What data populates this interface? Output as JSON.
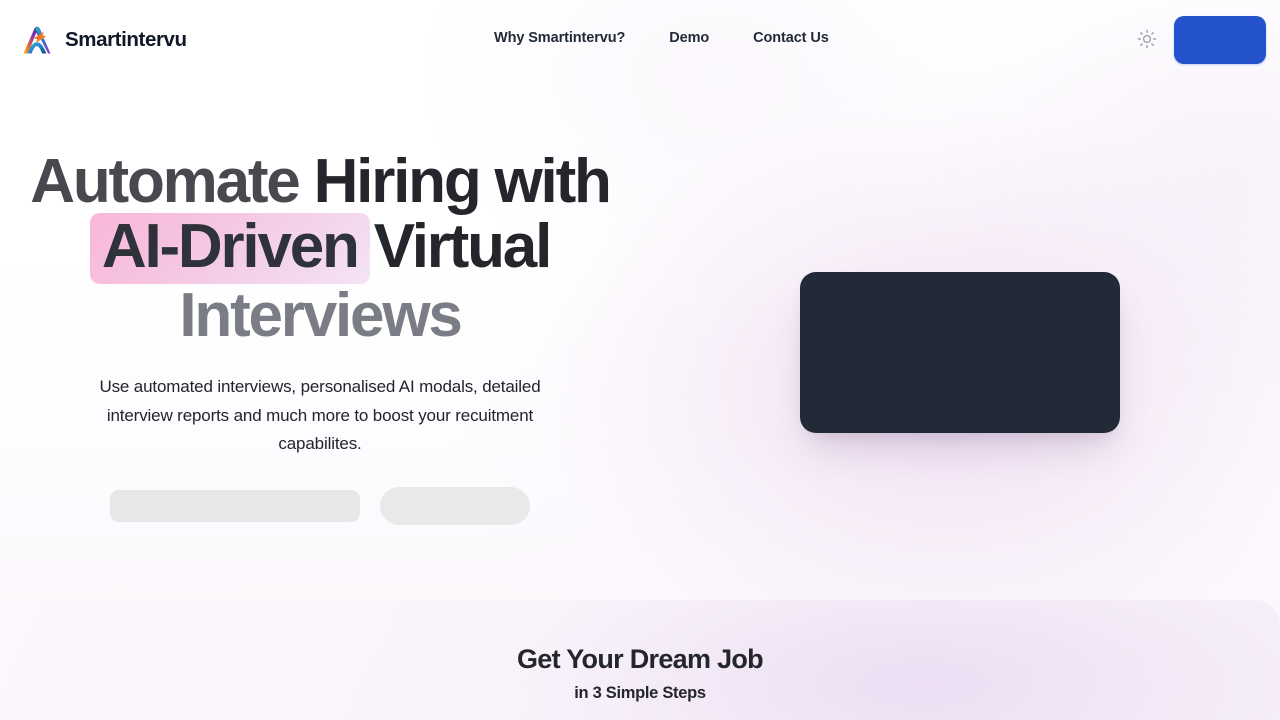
{
  "brand": {
    "name": "Smartintervu",
    "logo_icon": "smartintervu-logo-icon"
  },
  "nav": {
    "links": [
      {
        "label": "Why Smartintervu?"
      },
      {
        "label": "Demo"
      },
      {
        "label": "Contact Us"
      }
    ],
    "theme_toggle_icon": "sun-icon",
    "cta_label": ""
  },
  "hero": {
    "headline_line1_part1": "Automate ",
    "headline_line1_part2": "Hiring with",
    "headline_highlight": "AI-Driven",
    "headline_line2_rest": "Virtual",
    "headline_line3": "Interviews",
    "subheadline": "Use automated interviews, personalised AI modals, detailed interview reports and much more to boost your recuitment capabilites.",
    "primary_button_label": "",
    "secondary_button_label": "",
    "media_label": ""
  },
  "steps": {
    "title": "Get Your Dream Job",
    "subtitle": "in 3 Simple Steps"
  },
  "colors": {
    "brand_blue": "#2352cc",
    "highlight_pink": "#f9b7d9",
    "media_dark": "#222a38",
    "heading_dark": "#24262c",
    "heading_muted": "#7b7d86",
    "skeleton_gray": "#e7e7e8"
  }
}
